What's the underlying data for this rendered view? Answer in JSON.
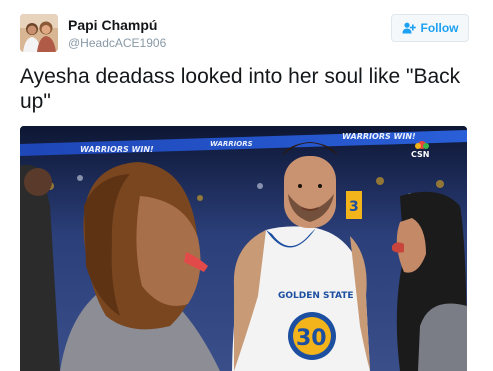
{
  "user": {
    "display_name": "Papi Champú",
    "handle": "@HeadcACE1906"
  },
  "follow_button": {
    "label": "Follow"
  },
  "tweet": {
    "text": "Ayesha deadass looked into her soul like \"Back up\""
  },
  "media": {
    "banner_left": "WARRIORS WIN!",
    "banner_mid": "WARRIORS",
    "banner_right": "WARRIORS WIN!",
    "network_logo": "CSN",
    "jersey_text": "GOLDEN STATE",
    "jersey_number": "30"
  },
  "colors": {
    "link_blue": "#1da1f2",
    "text": "#14171a",
    "muted": "#8899a6",
    "warriors_blue": "#1d4fa0",
    "warriors_gold": "#f3b41b"
  },
  "icons": {
    "follow": "add-person-icon"
  }
}
